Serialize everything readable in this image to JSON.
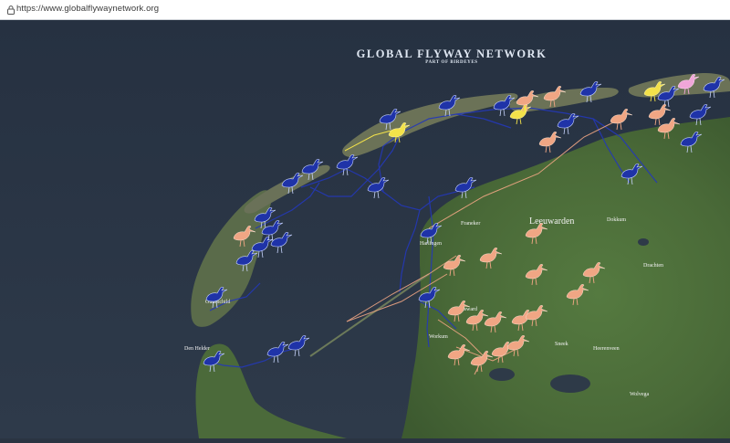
{
  "browser": {
    "url": "https://www.globalflywaynetwork.org"
  },
  "map": {
    "title": "GLOBAL FLYWAY NETWORK",
    "subtitle": "PART OF BIRDEYES",
    "places": {
      "leeuwarden": "Leeuwarden",
      "den_helder": "Den Helder",
      "bolsward": "Bolsward",
      "harlingen": "Harlingen",
      "drachten": "Drachten",
      "heerenveen": "Heerenveen",
      "sneek": "Sneek",
      "workum": "Workum",
      "wolvega": "Wolvega",
      "dokkum": "Dokkum",
      "franeker": "Franeker",
      "oudeschild": "Oudeschild"
    },
    "colors": {
      "sea": "#2c3747",
      "land": "#4d6a3b",
      "island": "#5f6e4e",
      "blue_bird": "#1f33a8",
      "salmon_bird": "#f0a684",
      "yellow_bird": "#f3e24a",
      "pink_bird": "#f0a6d8",
      "blue_track": "#2438b8",
      "salmon_track": "#f0a684"
    }
  }
}
